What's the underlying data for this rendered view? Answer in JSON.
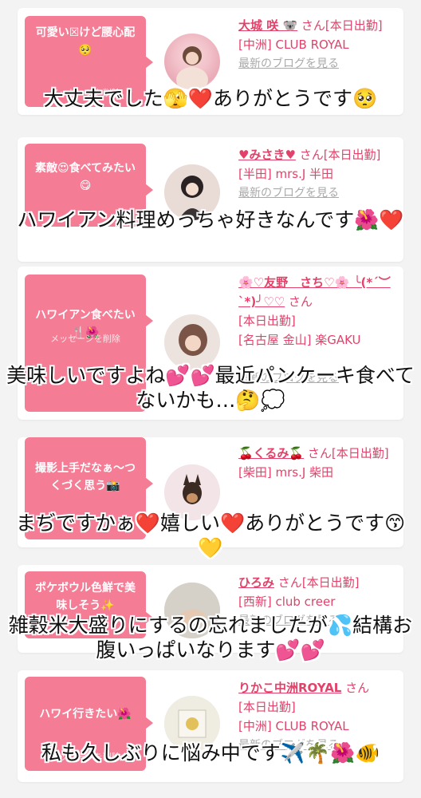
{
  "colors": {
    "accent_pink": "#f47c95",
    "link_pink": "#e2426a",
    "muted_link": "#aaaaaa",
    "background": "#f3f3f3"
  },
  "delete_label": "メッセージを削除",
  "blog_label": "最新のブログを見る",
  "cards": [
    {
      "message": "可愛い☒けど腰心配🥺",
      "cast_name": "大城 咲 🐨",
      "honorific": "さん",
      "status": "[本日出勤]",
      "store": "[中洲] CLUB ROYAL",
      "avatar_icon": "cherry-blossom-portrait",
      "reply": "大丈夫でした🫣❤️ありがとうです🥺"
    },
    {
      "message": "素敵😍食べてみたい😋",
      "cast_name": "♥みさき♥",
      "honorific": "さん",
      "status": "[本日出勤]",
      "store": "[半田] mrs.J 半田",
      "avatar_icon": "girl-portrait",
      "reply": "ハワイアン料理めっちゃ好きなんです🌺❤️"
    },
    {
      "message": "ハワイアン食べたい🍴🌺",
      "cast_name": "🌸♡友野　さち♡🌸 ╰(*´︶`*)╯♡♡",
      "honorific": "さん",
      "status": "[本日出勤]",
      "store": "[名古屋 金山] 楽GAKU",
      "avatar_icon": "woman-portrait",
      "reply": "美味しいですよね💕💕最近パンケーキ食べてないかも…🤔💭"
    },
    {
      "message": "撮影上手だなぁ〜つくづく思う📸",
      "cast_name": "🍒くるみ🍒",
      "honorific": "さん",
      "status": "[本日出勤]",
      "store": "[柴田] mrs.J 柴田",
      "avatar_icon": "puppy-portrait",
      "reply": "まぢですかぁ❤️嬉しい❤️ありがとうです😙💛"
    },
    {
      "message": "ポケボウル色鮮で美味しそう✨",
      "cast_name": "ひろみ",
      "honorific": "さん",
      "status": "[本日出勤]",
      "store": "[西新] club creer",
      "avatar_icon": "hand-portrait",
      "reply": "雑穀米大盛りにするの忘れましたが💦結構お腹いっぱいなります💕💕"
    },
    {
      "message": "ハワイ行きたい🌺",
      "cast_name": "りかこ中洲ROYAL",
      "honorific": "さん",
      "status": "[本日出勤]",
      "store": "[中洲] CLUB ROYAL",
      "avatar_icon": "photo-portrait",
      "reply": "私も久しぶりに悩み中です✈️🌴🌺🐠"
    }
  ]
}
